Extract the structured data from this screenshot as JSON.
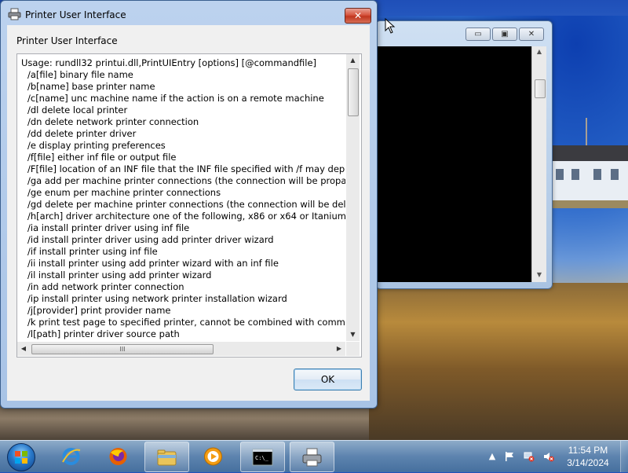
{
  "dialog": {
    "title": "Printer User Interface",
    "heading": "Printer User Interface",
    "ok_label": "OK",
    "close_glyph": "✕",
    "usage_lines": [
      "Usage: rundll32 printui.dll,PrintUIEntry [options] [@commandfile]",
      "/a[file] binary file name",
      "/b[name] base printer name",
      "/c[name] unc machine name if the action is on a remote machine",
      "/dl delete local printer",
      "/dn delete network printer connection",
      "/dd delete printer driver",
      "/e display printing preferences",
      "/f[file] either inf file or output file",
      "/F[file] location of an INF file that the INF file specified with /f may depend o",
      "/ga add per machine printer connections (the connection will be propagated",
      "/ge enum per machine printer connections",
      "/gd delete per machine printer connections (the connection will be deleted u",
      "/h[arch] driver architecture one of the following, x86 or x64 or Itanium",
      "/ia install printer driver using inf file",
      "/id install printer driver using add printer driver wizard",
      "/if install printer using inf file",
      "/ii install printer using add printer wizard with an inf file",
      "/il install printer using add printer wizard",
      "/in add network printer connection",
      "/ip install printer using network printer installation wizard",
      "/j[provider] print provider name",
      "/k print test page to specified printer, cannot be combined with command w",
      "/l[path] printer driver source path"
    ],
    "hscroll_grip": "III"
  },
  "console": {
    "minimize_glyph": "▭",
    "maximize_glyph": "▣",
    "close_glyph": "✕"
  },
  "taskbar": {
    "items": [
      {
        "name": "internet-explorer",
        "icon": "ie-icon"
      },
      {
        "name": "firefox",
        "icon": "firefox-icon"
      },
      {
        "name": "explorer",
        "icon": "folder-icon"
      },
      {
        "name": "media-player",
        "icon": "media-player-icon"
      },
      {
        "name": "command-prompt",
        "icon": "cmd-icon"
      },
      {
        "name": "printer",
        "icon": "printer-icon"
      }
    ],
    "time": "11:54 PM",
    "date": "3/14/2024"
  },
  "colors": {
    "accent": "#3c7fb1",
    "close_red": "#c0361f"
  }
}
